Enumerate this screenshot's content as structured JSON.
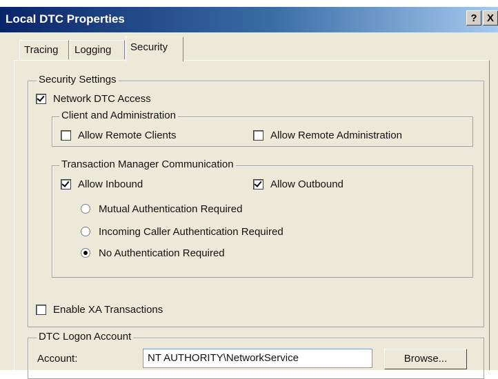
{
  "window": {
    "title": "Local DTC Properties",
    "help_button": "?",
    "close_button": "X"
  },
  "tabs": [
    {
      "label": "Tracing",
      "active": false
    },
    {
      "label": "Logging",
      "active": false
    },
    {
      "label": "Security",
      "active": true
    }
  ],
  "security_settings": {
    "group_label": "Security Settings",
    "network_dtc_access": {
      "label": "Network DTC Access",
      "checked": true
    },
    "client_admin": {
      "group_label": "Client and Administration",
      "allow_remote_clients": {
        "label": "Allow Remote Clients",
        "checked": false
      },
      "allow_remote_admin": {
        "label": "Allow Remote Administration",
        "checked": false
      }
    },
    "tm_comm": {
      "group_label": "Transaction Manager Communication",
      "allow_inbound": {
        "label": "Allow Inbound",
        "checked": true
      },
      "allow_outbound": {
        "label": "Allow Outbound",
        "checked": true
      },
      "auth_options": [
        {
          "label": "Mutual Authentication Required",
          "selected": false
        },
        {
          "label": "Incoming Caller Authentication Required",
          "selected": false
        },
        {
          "label": "No Authentication Required",
          "selected": true
        }
      ]
    },
    "enable_xa": {
      "label": "Enable XA Transactions",
      "checked": false
    }
  },
  "logon_account": {
    "group_label": "DTC Logon Account",
    "account_label": "Account:",
    "account_value": "NT AUTHORITY\\NetworkService",
    "browse_label": "Browse..."
  }
}
